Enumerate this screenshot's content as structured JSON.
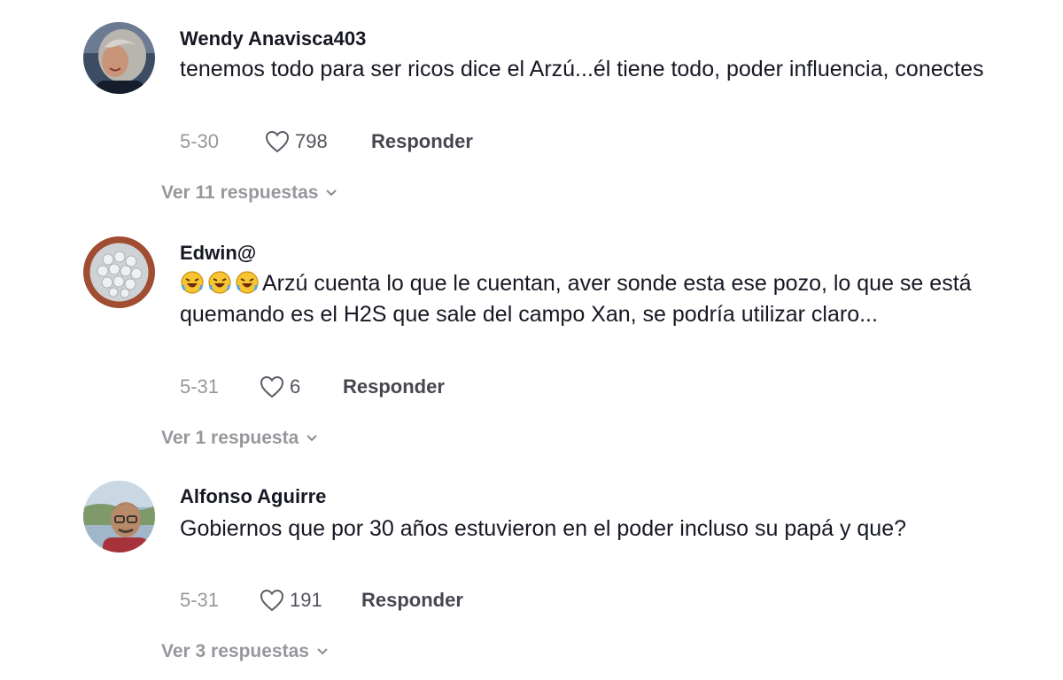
{
  "comments": [
    {
      "username": "Wendy Anavisca403",
      "text": "tenemos todo para ser ricos dice el Arzú...él tiene todo, poder influencia, conectes",
      "date": "5-30",
      "likes": "798",
      "reply_label": "Responder",
      "view_replies": "Ver 11 respuestas",
      "avatar_icon": "woman-portrait-avatar"
    },
    {
      "username": "Edwin@",
      "emojis": [
        "rolling-on-floor-laughing-emoji",
        "rolling-on-floor-laughing-emoji",
        "rolling-on-floor-laughing-emoji"
      ],
      "text": "Arzú cuenta lo que le cuentan, aver sonde esta ese pozo, lo que se está quemando es el H2S que sale del campo Xan, se podría utilizar claro...",
      "date": "5-31",
      "likes": "6",
      "reply_label": "Responder",
      "view_replies": "Ver 1 respuesta",
      "avatar_icon": "pearls-bowl-avatar"
    },
    {
      "username": "Alfonso Aguirre",
      "text": "Gobiernos que por 30 años estuvieron en el poder incluso su papá y que?",
      "date": "5-31",
      "likes": "191",
      "reply_label": "Responder",
      "view_replies": "Ver 3 respuestas",
      "avatar_icon": "man-with-glasses-avatar"
    }
  ],
  "colors": {
    "text": "#161823",
    "muted": "rgba(22,24,35,0.45)",
    "background": "#ffffff"
  },
  "icons": {
    "like": "heart-outline-icon",
    "expand": "chevron-down-icon"
  }
}
